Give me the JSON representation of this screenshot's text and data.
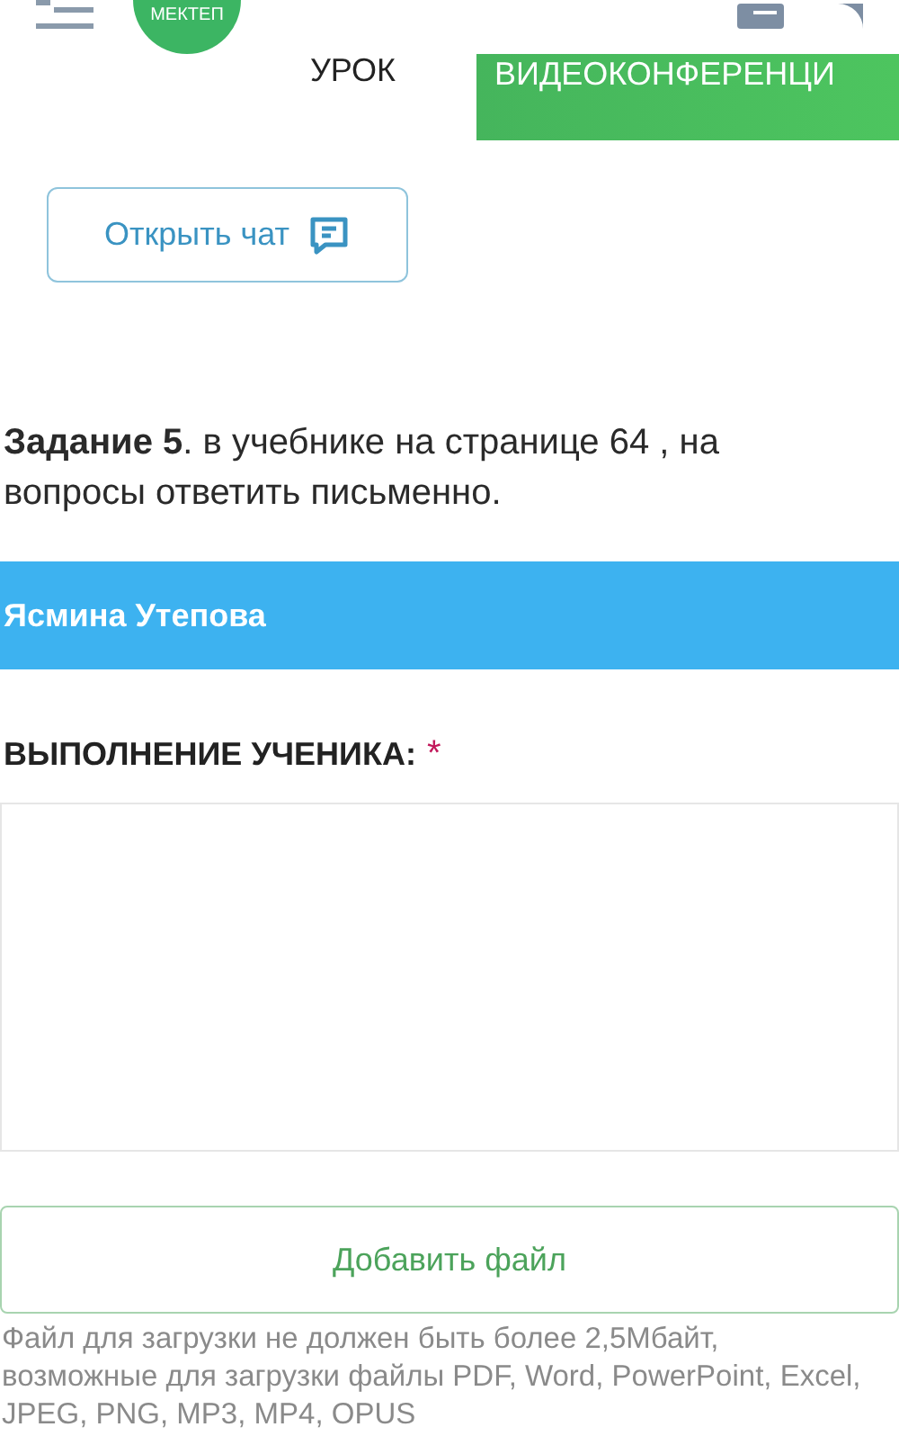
{
  "header": {
    "logo": "МЕКТЕП"
  },
  "lesson_tabs": [
    {
      "label": "УРОК",
      "kind": "plain"
    },
    {
      "label": "ВИДЕОКОНФЕРЕНЦИ",
      "kind": "filled"
    }
  ],
  "chat_button": {
    "label": "Открыть чат"
  },
  "task": {
    "text": "**Задание 5**. в учебнике на странице 64 , на вопросы ответить письменно."
  },
  "student_bar": {
    "name": "Ясмина Утепова"
  },
  "answer": {
    "label": "ВЫПОЛНЕНИЕ УЧЕНИКА:",
    "required_mark": "*"
  },
  "add_file_button": {
    "label": "Добавить файл"
  },
  "file_note": "Файл для загрузки не должен быть более 2,5Мбайт, возможные для загрузки файлы PDF, Word, PowerPoint, Excel, JPEG, PNG, MP3, MP4, OPUS"
}
